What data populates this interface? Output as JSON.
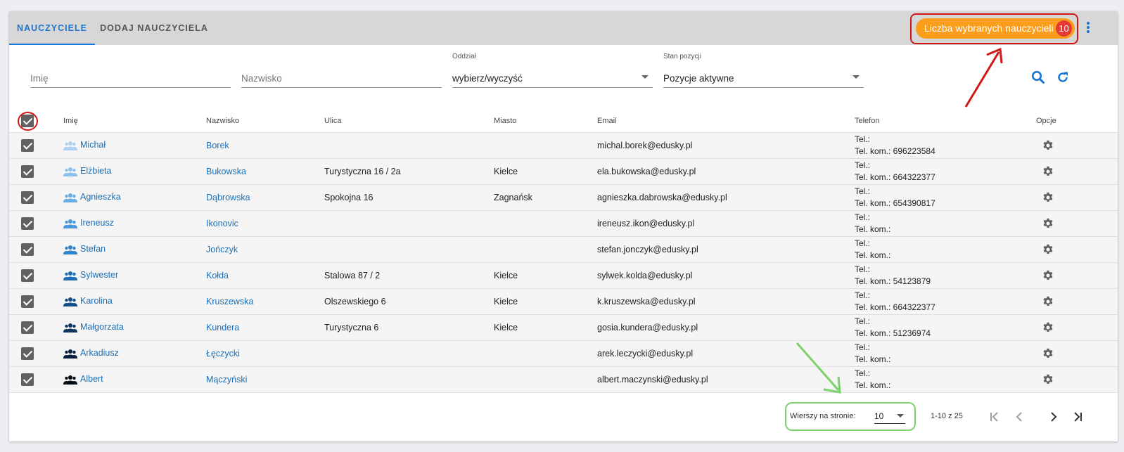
{
  "tabs": [
    {
      "label": "NAUCZYCIELE",
      "active": true
    },
    {
      "label": "DODAJ NAUCZYCIELA",
      "active": false
    }
  ],
  "selected_badge": {
    "label": "Liczba wybranych nauczycieli",
    "count": "10",
    "color": "#fb9e1b",
    "count_color": "#e53935"
  },
  "filters": {
    "first_name_placeholder": "Imię",
    "last_name_placeholder": "Nazwisko",
    "branch_label": "Oddział",
    "branch_value": "wybierz/wyczyść",
    "position_label": "Stan pozycji",
    "position_value": "Pozycje aktywne"
  },
  "columns": {
    "first_name": "Imię",
    "last_name": "Nazwisko",
    "street": "Ulica",
    "city": "Miasto",
    "email": "Email",
    "phone": "Telefon",
    "options": "Opcje"
  },
  "rows": [
    {
      "first": "Michał",
      "last": "Borek",
      "street": "",
      "city": "",
      "email": "michal.borek@edusky.pl",
      "tel": "Tel.:",
      "mobile": "Tel. kom.: 696223584",
      "icon_color": "#aed1f0"
    },
    {
      "first": "Elżbieta",
      "last": "Bukowska",
      "street": "Turystyczna 16 / 2a",
      "city": "Kielce",
      "email": "ela.bukowska@edusky.pl",
      "tel": "Tel.:",
      "mobile": "Tel. kom.: 664322377",
      "icon_color": "#8fc0ec"
    },
    {
      "first": "Agnieszka",
      "last": "Dąbrowska",
      "street": "Spokojna 16",
      "city": "Zagnańsk",
      "email": "agnieszka.dabrowska@edusky.pl",
      "tel": "Tel.:",
      "mobile": "Tel. kom.: 654390817",
      "icon_color": "#6aaee6"
    },
    {
      "first": "Ireneusz",
      "last": "Ikonovic",
      "street": "",
      "city": "",
      "email": "ireneusz.ikon@edusky.pl",
      "tel": "Tel.:",
      "mobile": "Tel. kom.:",
      "icon_color": "#4a98dc"
    },
    {
      "first": "Stefan",
      "last": "Jończyk",
      "street": "",
      "city": "",
      "email": "stefan.jonczyk@edusky.pl",
      "tel": "Tel.:",
      "mobile": "Tel. kom.:",
      "icon_color": "#2f82cc"
    },
    {
      "first": "Sylwester",
      "last": "Kołda",
      "street": "Stalowa 87 / 2",
      "city": "Kielce",
      "email": "sylwek.kolda@edusky.pl",
      "tel": "Tel.:",
      "mobile": "Tel. kom.: 54123879",
      "icon_color": "#1c6db5"
    },
    {
      "first": "Karolina",
      "last": "Kruszewska",
      "street": "Olszewskiego 6",
      "city": "Kielce",
      "email": "k.kruszewska@edusky.pl",
      "tel": "Tel.:",
      "mobile": "Tel. kom.: 664322377",
      "icon_color": "#12508c"
    },
    {
      "first": "Małgorzata",
      "last": "Kundera",
      "street": "Turystyczna 6",
      "city": "Kielce",
      "email": "gosia.kundera@edusky.pl",
      "tel": "Tel.:",
      "mobile": "Tel. kom.: 51236974",
      "icon_color": "#0c3560"
    },
    {
      "first": "Arkadiusz",
      "last": "Łęczycki",
      "street": "",
      "city": "",
      "email": "arek.leczycki@edusky.pl",
      "tel": "Tel.:",
      "mobile": "Tel. kom.:",
      "icon_color": "#071f3a"
    },
    {
      "first": "Albert",
      "last": "Mączyński",
      "street": "",
      "city": "",
      "email": "albert.maczynski@edusky.pl",
      "tel": "Tel.:",
      "mobile": "Tel. kom.:",
      "icon_color": "#050d17"
    }
  ],
  "pagination": {
    "rows_per_page_label": "Wierszy na stronie:",
    "rows_per_page_value": "10",
    "range": "1-10 z 25",
    "first_icon": "first-page-icon",
    "prev_icon": "chevron-left-icon",
    "next_icon": "chevron-right-icon",
    "last_icon": "last-page-icon"
  },
  "annotations": {
    "red": "#d01818",
    "green": "#7cd16a"
  }
}
